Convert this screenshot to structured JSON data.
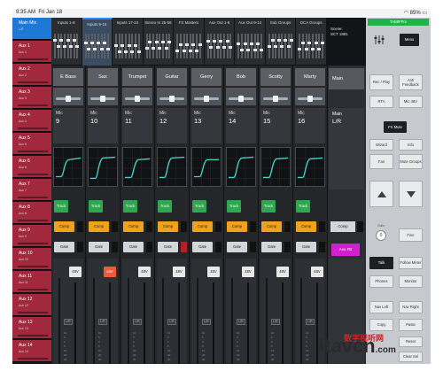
{
  "status_bar": {
    "time": "9:35 AM",
    "date": "Fri Jan 18",
    "battery": "85%"
  },
  "sidebar": {
    "items": [
      {
        "label": "Main Mix",
        "sub": "L/R",
        "active": true
      },
      {
        "label": "Aux 1",
        "sub": "Aux 1"
      },
      {
        "label": "Aux 2",
        "sub": "Aux 2"
      },
      {
        "label": "Aux 3",
        "sub": "Aux 3"
      },
      {
        "label": "Aux 4",
        "sub": "Aux 4"
      },
      {
        "label": "Aux 5",
        "sub": "Aux 5"
      },
      {
        "label": "Aux 6",
        "sub": "Aux 6"
      },
      {
        "label": "Aux 7",
        "sub": "Aux 7"
      },
      {
        "label": "Aux 8",
        "sub": "Aux 8"
      },
      {
        "label": "Aux 9",
        "sub": "Aux 9"
      },
      {
        "label": "Aux 10",
        "sub": "Aux 10"
      },
      {
        "label": "Aux 11",
        "sub": "Aux 11"
      },
      {
        "label": "Aux 12",
        "sub": "Aux 12"
      },
      {
        "label": "Aux 13",
        "sub": "Aux 13"
      },
      {
        "label": "Aux 14",
        "sub": "Aux 14"
      }
    ]
  },
  "tabs": [
    {
      "label": "Inputs 1-8"
    },
    {
      "label": "Inputs 9-16",
      "active": true
    },
    {
      "label": "Inputs 17-24"
    },
    {
      "label": "Stereo In 25-56"
    },
    {
      "label": "FX Masters"
    },
    {
      "label": "Aux Out 1-8"
    },
    {
      "label": "Aux Out 9-14"
    },
    {
      "label": "Sub Groups"
    },
    {
      "label": "DCA Groups"
    }
  ],
  "scene": {
    "label": "Scene:",
    "value": "SCT 1881"
  },
  "channels": [
    {
      "name": "E Bass",
      "src": "Mic",
      "num": "9",
      "phantom": false,
      "gate_active": false
    },
    {
      "name": "Sax",
      "src": "Mic",
      "num": "10",
      "phantom": true,
      "gate_active": false
    },
    {
      "name": "Trumpet",
      "src": "Mic",
      "num": "11",
      "phantom": false,
      "gate_active": false
    },
    {
      "name": "Guitar",
      "src": "Mic",
      "num": "12",
      "phantom": false,
      "gate_active": true
    },
    {
      "name": "Gerry",
      "src": "Mic",
      "num": "13",
      "phantom": false,
      "gate_active": false
    },
    {
      "name": "Bob",
      "src": "Mic",
      "num": "14",
      "phantom": false,
      "gate_active": false
    },
    {
      "name": "Scotty",
      "src": "Mic",
      "num": "15",
      "phantom": false,
      "gate_active": false
    },
    {
      "name": "Marty",
      "src": "Mic",
      "num": "16",
      "phantom": false,
      "gate_active": false
    }
  ],
  "strip_buttons": {
    "track": "Track",
    "comp": "Comp",
    "gate": "Gate",
    "phantom": "48V",
    "fader_cap": "L/R"
  },
  "scale_marks": [
    "10",
    "5",
    "0",
    "5",
    "10",
    "20",
    "30"
  ],
  "main": {
    "name": "Main",
    "src": "Main",
    "bus": "L/R",
    "comp": "Comp",
    "fx": "Aux FB"
  },
  "right_panel": {
    "top_label": "TAB8FPro",
    "menu": "Menu",
    "rec_play": "Rec / Play",
    "anti_feedback": "Anti Feedback",
    "rta": "RTA",
    "mic_48v": "Mic 48V",
    "fx_mute": "FX Mute",
    "wizard": "Wizard",
    "info": "Info",
    "fan": "Fan",
    "mute_groups": "Mute Groups",
    "gain_label": "Gain",
    "gain_value": "0",
    "fine": "Fine",
    "talk": "Talk",
    "follow_meter": "Follow Meter",
    "phones": "Phones",
    "monitor": "Monitor",
    "nav_left": "Nav Left",
    "nav_right": "Nav Right",
    "copy": "Copy",
    "paste": "Paste",
    "reset": "Reset",
    "clear_sel": "Clear Sel"
  },
  "watermark": {
    "brand": "itavcn",
    "suffix": ".com",
    "cn_text": "数字视听网"
  },
  "colors": {
    "active_blue": "#1e78d6",
    "aux_red": "#a1283d",
    "track_green": "#2fa64f",
    "comp_orange": "#f0a21b",
    "phantom_on": "#f05a3c",
    "fx_magenta": "#d21fd1",
    "status_green": "#1fb14c"
  }
}
